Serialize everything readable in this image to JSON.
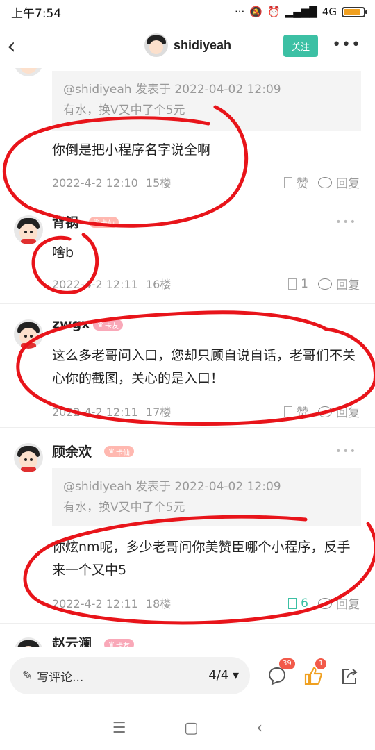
{
  "status": {
    "time": "上午7:54",
    "network": "4G",
    "icons": [
      "dots-icon",
      "mute-icon",
      "alarm-icon",
      "signal-icon",
      "hd-icon",
      "battery-icon"
    ]
  },
  "nav": {
    "back": "‹",
    "username": "shidiyeah",
    "follow": "关注",
    "more": "•••"
  },
  "comments": [
    {
      "quote_line1": "@shidiyeah 发表于 2022-04-02 12:09",
      "quote_line2": "有水，换V又中了个5元",
      "text": "你倒是把小程序名字说全啊",
      "time": "2022-4-2 12:10",
      "floor": "15楼",
      "like": "赞",
      "reply": "回复"
    },
    {
      "name": "背锅",
      "badge": "卡仙",
      "text": "啥b",
      "time": "2022-4-2 12:11",
      "floor": "16楼",
      "like": "1",
      "reply": "回复"
    },
    {
      "name": "zwgx",
      "badge": "卡友",
      "text": "这么多老哥问入口，您却只顾自说自话，老哥们不关心你的截图，关心的是入口！",
      "time": "2022-4-2 12:11",
      "floor": "17楼",
      "like": "赞",
      "reply": "回复"
    },
    {
      "name": "顾余欢",
      "badge": "卡仙",
      "quote_line1": "@shidiyeah 发表于 2022-04-02 12:09",
      "quote_line2": "有水，换V又中了个5元",
      "text": "你炫nm呢，多少老哥问你美赞臣哪个小程序，反手来一个又中5",
      "time": "2022-4-2 12:11",
      "floor": "18楼",
      "like": "6",
      "reply": "回复"
    },
    {
      "name": "赵云澜",
      "badge": "卡友"
    }
  ],
  "bottom": {
    "write": "写评论...",
    "pages": "4/4",
    "comment_count": "39",
    "like_count": "1"
  },
  "sysnav": {
    "menu": "☰",
    "home": "▢",
    "back": "‹"
  },
  "colors": {
    "accent": "#3cc0a4",
    "annotation": "#e8141a",
    "badge": "#f25a4a"
  }
}
